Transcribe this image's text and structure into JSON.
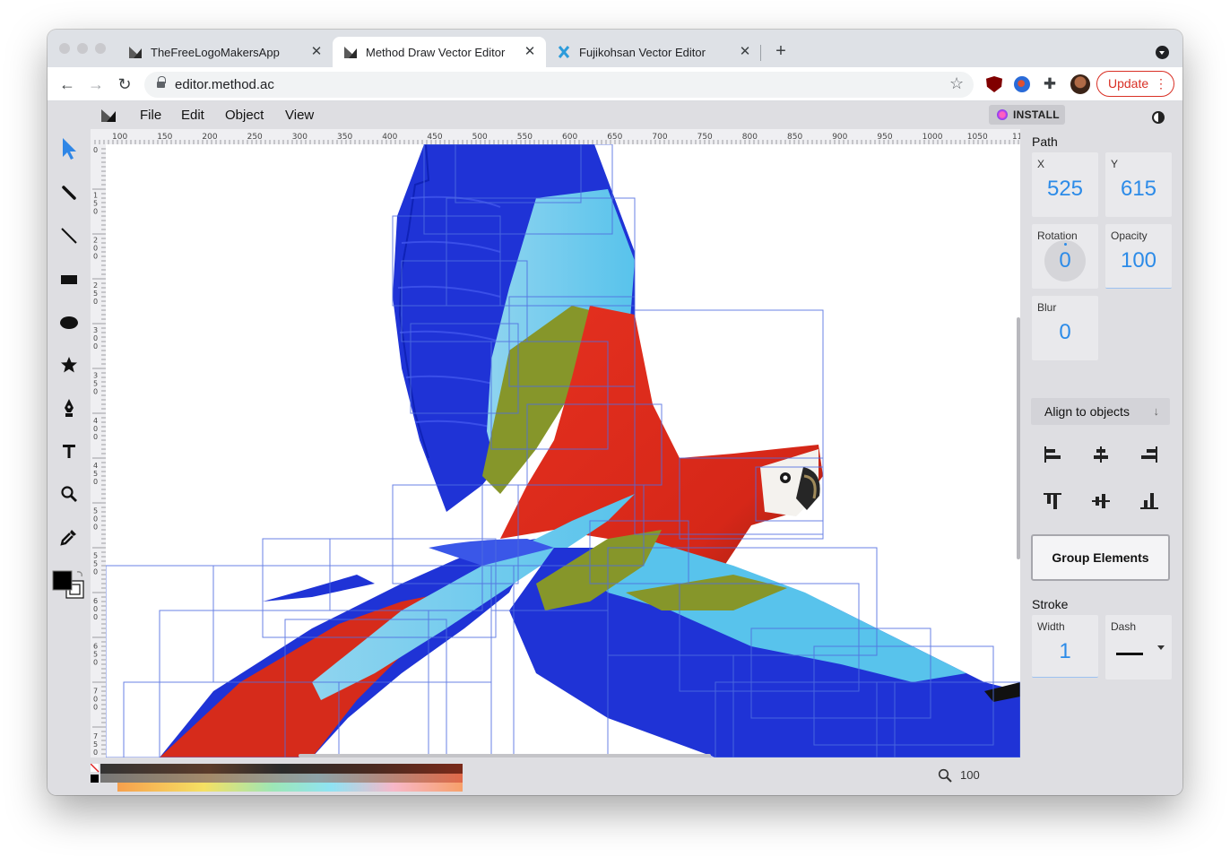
{
  "browser": {
    "tabs": [
      {
        "title": "TheFreeLogoMakersApp",
        "icon": "logo-maker-favicon",
        "active": false
      },
      {
        "title": "Method Draw Vector Editor",
        "icon": "method-draw-favicon",
        "active": true
      },
      {
        "title": "Fujikohsan Vector Editor",
        "icon": "fujikohsan-favicon",
        "active": false
      }
    ],
    "new_tab": "+",
    "url": "editor.method.ac",
    "update_label": "Update"
  },
  "editor": {
    "menus": [
      "File",
      "Edit",
      "Object",
      "View"
    ],
    "install_label": "INSTALL",
    "ruler_top": [
      "100",
      "150",
      "200",
      "250",
      "300",
      "350",
      "400",
      "450",
      "500",
      "550",
      "600",
      "650",
      "700",
      "750",
      "800",
      "850",
      "900",
      "950",
      "1000",
      "1050",
      "11"
    ],
    "ruler_left": [
      "0",
      "150",
      "200",
      "250",
      "300",
      "350",
      "400",
      "450",
      "500",
      "550",
      "600",
      "650",
      "700",
      "750"
    ],
    "tools": [
      "select-arrow-icon",
      "pencil-icon",
      "line-icon",
      "rectangle-icon",
      "ellipse-icon",
      "star-icon",
      "pen-icon",
      "text-icon",
      "zoom-icon",
      "eyedropper-icon"
    ],
    "fill_color": "#000000",
    "stroke_color": "#ffffff",
    "zoom": "100"
  },
  "panel": {
    "title": "Path",
    "x_label": "X",
    "x_value": "525",
    "y_label": "Y",
    "y_value": "615",
    "rotation_label": "Rotation",
    "rotation_value": "0",
    "opacity_label": "Opacity",
    "opacity_value": "100",
    "blur_label": "Blur",
    "blur_value": "0",
    "align_label": "Align to objects",
    "group_label": "Group Elements",
    "stroke_title": "Stroke",
    "width_label": "Width",
    "width_value": "1",
    "dash_label": "Dash"
  },
  "colors": {
    "accent": "#2c8be8",
    "macaw_red": "#e0301e",
    "macaw_blue": "#1f33d6",
    "macaw_light_blue": "#58c3ec",
    "macaw_olive": "#86962a",
    "selection_box": "#4f6de0"
  }
}
